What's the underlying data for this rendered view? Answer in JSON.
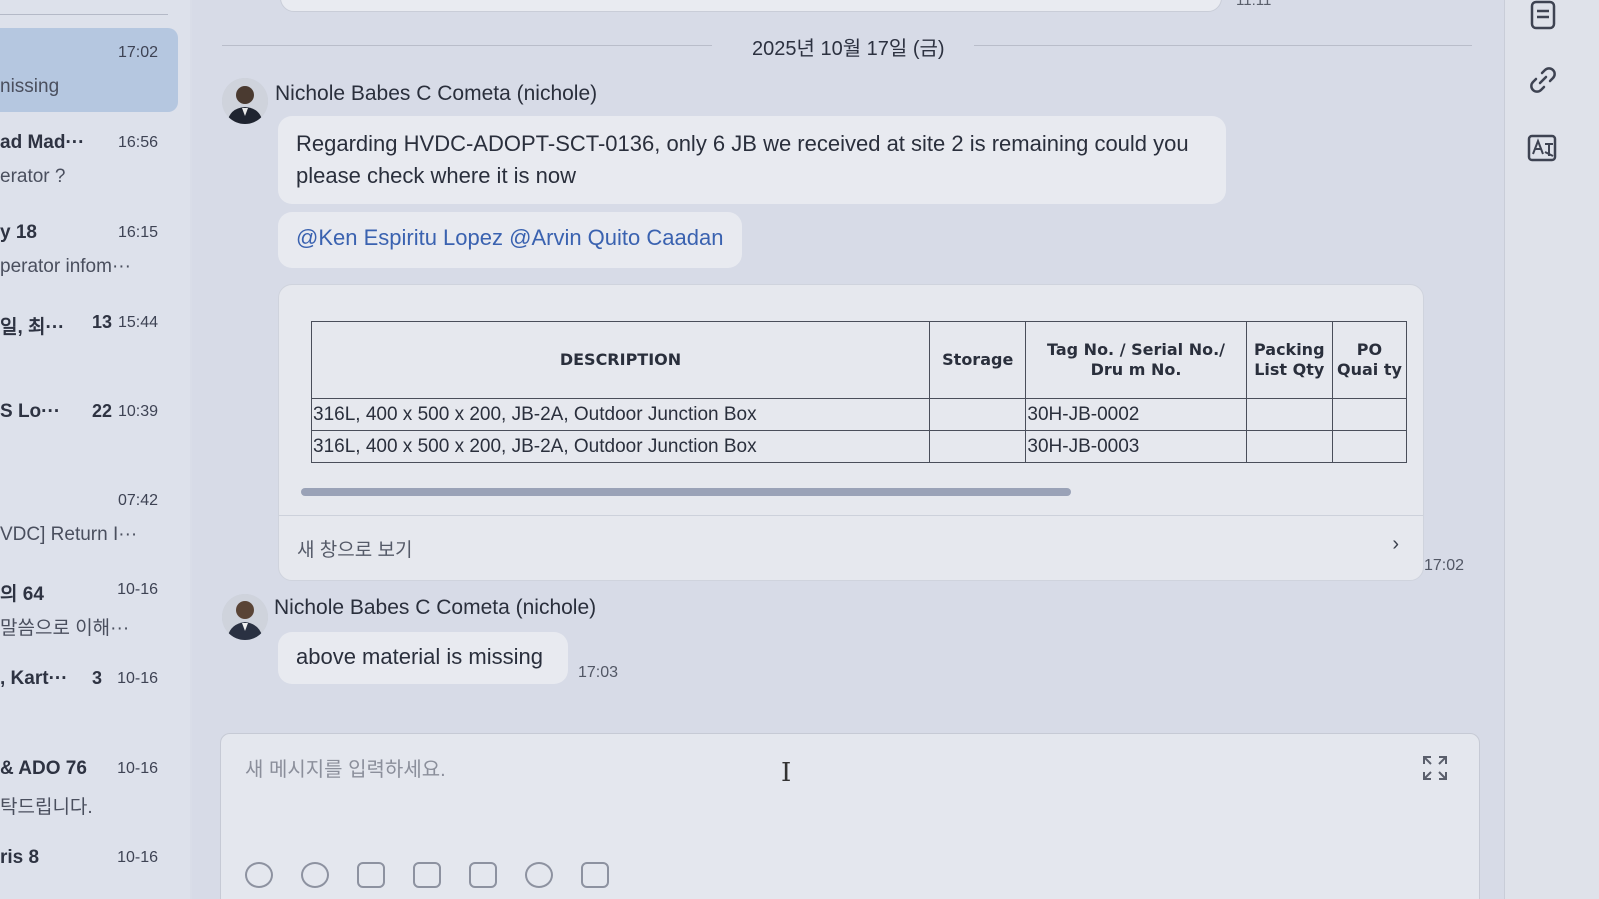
{
  "sidebar": {
    "conversations": [
      {
        "name": "",
        "count": "",
        "time": "17:02",
        "preview": "nissing",
        "active": true
      },
      {
        "name": "ad Mad···",
        "count": "",
        "time": "16:56",
        "preview": "erator ?",
        "active": false
      },
      {
        "name": "y 18",
        "count": "",
        "time": "16:15",
        "preview": "perator infom···",
        "active": false
      },
      {
        "name": "일, 최···",
        "count": "13",
        "time": "15:44",
        "preview": "",
        "active": false
      },
      {
        "name": "S Lo···",
        "count": "22",
        "time": "10:39",
        "preview": "",
        "active": false
      },
      {
        "name": "",
        "count": "",
        "time": "07:42",
        "preview": "VDC] Return I···",
        "active": false
      },
      {
        "name": "의 64",
        "count": "",
        "time": "10-16",
        "preview": "말씀으로 이해···",
        "active": false
      },
      {
        "name": ", Kart···",
        "count": "3",
        "time": "10-16",
        "preview": "",
        "active": false
      },
      {
        "name": "& ADO 76",
        "count": "",
        "time": "10-16",
        "preview": "탁드립니다.",
        "active": false
      },
      {
        "name": "ris 8",
        "count": "",
        "time": "10-16",
        "preview": "",
        "active": false
      }
    ]
  },
  "chat": {
    "previous_time": "11:11",
    "date_separator": "2025년 10월 17일 (금)",
    "messages": [
      {
        "sender": "Nichole Babes C Cometa (nichole)",
        "text": "Regarding HVDC-ADOPT-SCT-0136, only 6 JB we received at site 2 is remaining could you please check where it is now",
        "mention": "@Ken Espiritu Lopez @Arvin Quito Caadan",
        "time": "17:02"
      },
      {
        "sender": "Nichole Babes C Cometa (nichole)",
        "text": "above material is missing",
        "time": "17:03"
      }
    ],
    "table": {
      "headers": [
        "DESCRIPTION",
        "Storage",
        "Tag No. / Serial No./ Dru m No.",
        "Packing List Qty",
        "PO Quai ty"
      ],
      "rows": [
        [
          "316L, 400 x 500 x 200, JB-2A, Outdoor Junction Box",
          "",
          "30H-JB-0002",
          "",
          ""
        ],
        [
          "316L, 400 x 500 x 200, JB-2A, Outdoor Junction Box",
          "",
          "30H-JB-0003",
          "",
          ""
        ]
      ],
      "open_new_window": "새 창으로 보기",
      "scroll_fraction": 0.7
    }
  },
  "composer": {
    "placeholder": "새 메시지를 입력하세요."
  },
  "icons": {
    "rail": [
      "notes-icon",
      "link-icon",
      "translate-icon"
    ],
    "toolbar": [
      "emoji-icon",
      "mention-icon",
      "image-icon",
      "check-icon",
      "calendar-icon",
      "search-icon",
      "text-format-icon"
    ]
  }
}
